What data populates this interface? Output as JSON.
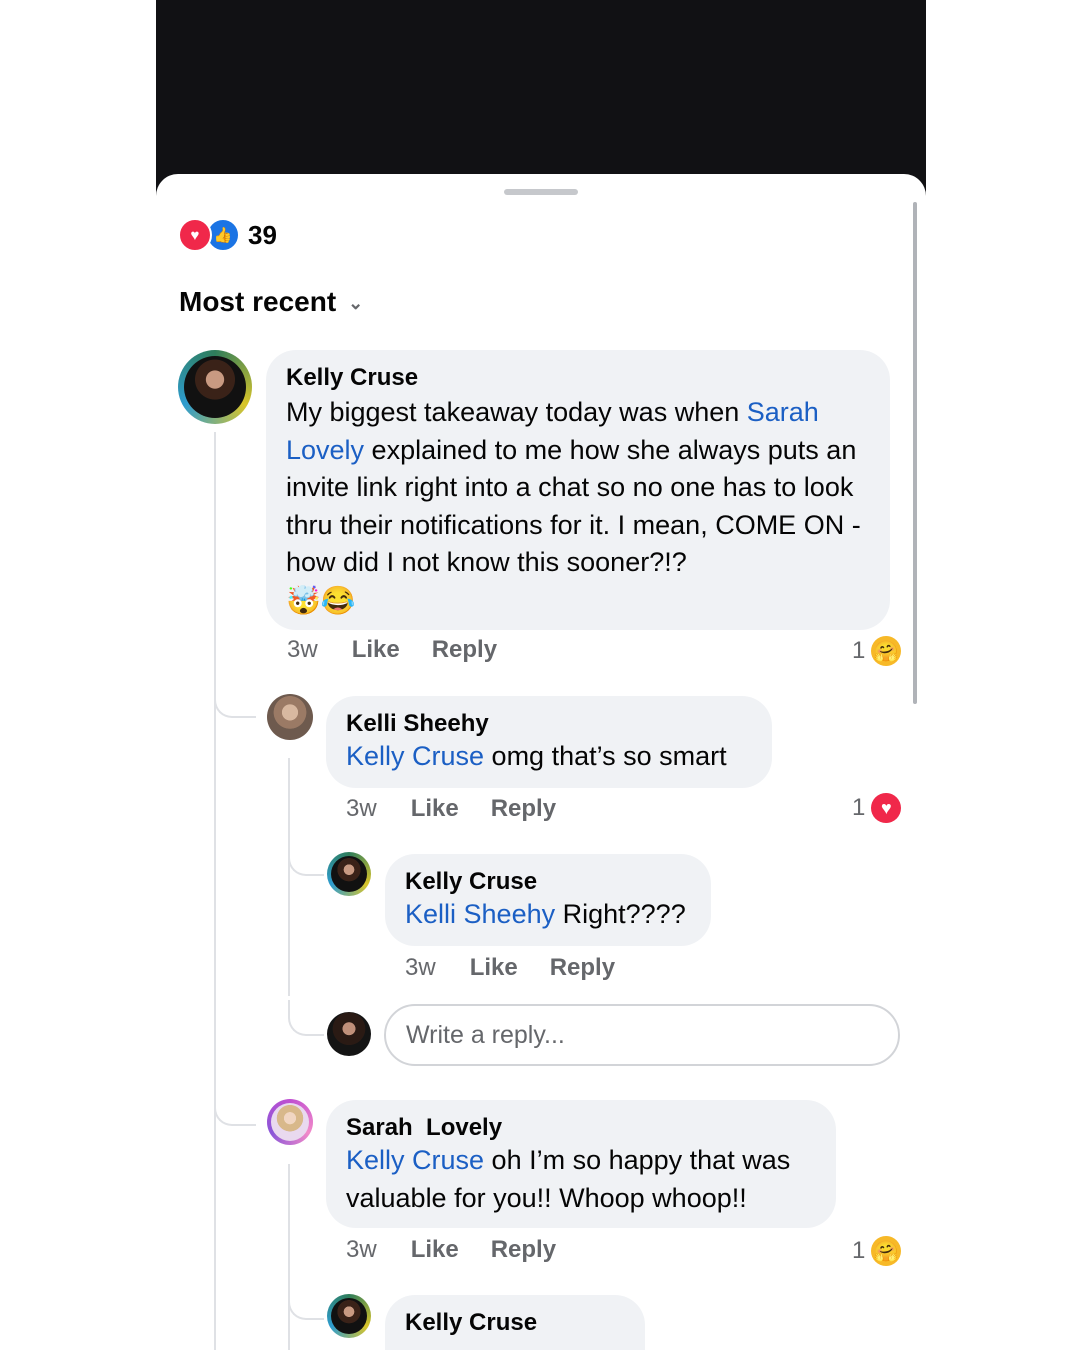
{
  "post_reactions": {
    "icons": [
      "heart-reaction",
      "like-reaction"
    ],
    "count": "39"
  },
  "sort": {
    "label": "Most recent",
    "icon": "chevron-down-icon"
  },
  "comments": [
    {
      "author": "Kelly Cruse",
      "text_before": "My biggest takeaway today was when ",
      "mention": "Sarah Lovely",
      "text_after": " explained to me how she always puts an invite link right into a chat so no one has to look thru their notifications for it. I mean, COME ON - how did I not know this sooner?!?",
      "emojis": "🤯😂",
      "time": "3w",
      "like": "Like",
      "reply": "Reply",
      "reaction_count": "1",
      "reaction": "care"
    },
    {
      "author": "Kelli Sheehy",
      "mention": "Kelly Cruse",
      "text_after": " omg that’s so smart",
      "time": "3w",
      "like": "Like",
      "reply": "Reply",
      "reaction_count": "1",
      "reaction": "love"
    },
    {
      "author": "Kelly Cruse",
      "mention": "Kelli Sheehy",
      "text_after": " Right????",
      "time": "3w",
      "like": "Like",
      "reply": "Reply"
    },
    {
      "author": "Sarah  Lovely",
      "mention": "Kelly Cruse",
      "text_after": " oh I’m so happy that was valuable for you!! Whoop whoop!!",
      "time": "3w",
      "like": "Like",
      "reply": "Reply",
      "reaction_count": "1",
      "reaction": "care"
    },
    {
      "author": "Kelly Cruse"
    }
  ],
  "reply_box": {
    "placeholder": "Write a reply..."
  },
  "colors": {
    "mention": "#1b5fc4",
    "bubble": "#f0f2f5",
    "love": "#f0284a",
    "like": "#1b74e4",
    "care": "#f7b928"
  }
}
